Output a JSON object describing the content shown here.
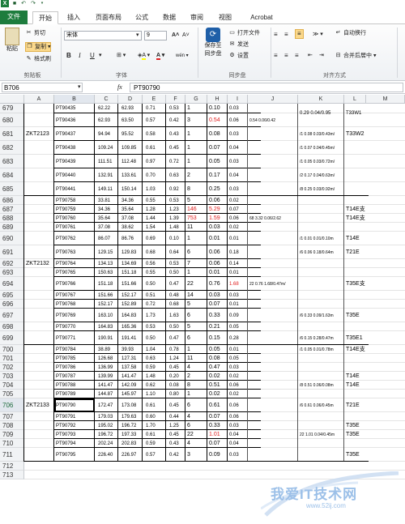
{
  "quick_access": {
    "save_icon": "save-icon",
    "undo_icon": "undo-icon",
    "redo_icon": "redo-icon",
    "app_icon": "excel-icon"
  },
  "tabs": [
    "文件",
    "开始",
    "插入",
    "页面布局",
    "公式",
    "数据",
    "审阅",
    "视图",
    "Acrobat"
  ],
  "clipboard": {
    "paste": "粘贴",
    "cut": "剪切",
    "copy": "复制",
    "format_painter": "格式刷",
    "group": "剪贴板"
  },
  "font": {
    "name": "宋体",
    "size": "9",
    "bold": "B",
    "italic": "I",
    "underline": "U",
    "group": "字体",
    "fill_letter": "A",
    "font_color_letter": "A",
    "grow": "A",
    "shrink": "A"
  },
  "sync": {
    "save_to": "保存至",
    "sync_drive": "同步盘",
    "open_file": "打开文件",
    "send": "发送",
    "settings": "设置",
    "group": "同步盘"
  },
  "alignment": {
    "wrap": "自动换行",
    "merge": "合并后居中",
    "group": "对齐方式"
  },
  "formula_bar": {
    "name_box": "B706",
    "fx": "fx",
    "value": "PT90790"
  },
  "columns": [
    "A",
    "B",
    "C",
    "D",
    "E",
    "F",
    "G",
    "H",
    "I",
    "J",
    "K",
    "L",
    "M"
  ],
  "rows": [
    {
      "n": "679",
      "b": "PT90435",
      "c": "62.22",
      "d": "62.93",
      "e": "0.71",
      "f": "0.53",
      "g": "1",
      "h": "0.10",
      "i": "0.03"
    },
    {
      "n": "680",
      "b": "PT90436",
      "c": "62.93",
      "d": "63.50",
      "e": "0.57",
      "f": "0.42",
      "g": "3",
      "h": "0.54",
      "i": "0.06",
      "j": "0.54 0.06/0.42"
    },
    {
      "n": "681",
      "a": "ZKT2123",
      "b": "PT90437",
      "c": "94.94",
      "d": "95.52",
      "e": "0.58",
      "f": "0.43",
      "g": "1",
      "h": "0.08",
      "i": "0.03",
      "k": "/1 0.08 0.03/0.43m/",
      "l": "T33W2"
    },
    {
      "n": "682",
      "b": "PT90438",
      "c": "109.24",
      "d": "109.85",
      "e": "0.61",
      "f": "0.45",
      "g": "1",
      "h": "0.07",
      "i": "0.04",
      "k": "/1 0.07 0.04/0.45m/"
    },
    {
      "n": "683",
      "b": "PT90439",
      "c": "111.51",
      "d": "112.48",
      "e": "0.97",
      "f": "0.72",
      "g": "1",
      "h": "0.05",
      "i": "0.03",
      "k": "/1 0.05 0.03/0.72m/"
    },
    {
      "n": "684",
      "b": "PT90440",
      "c": "132.91",
      "d": "133.61",
      "e": "0.70",
      "f": "0.63",
      "g": "2",
      "h": "0.17",
      "i": "0.04",
      "k": "/2 0.17 0.04/0.63m/"
    },
    {
      "n": "685",
      "b": "PT90441",
      "c": "149.11",
      "d": "150.14",
      "e": "1.03",
      "f": "0.92",
      "g": "8",
      "h": "0.25",
      "i": "0.03",
      "k": "/8 0.25 0.03/0.92m/"
    },
    {
      "n": "686",
      "b": "PT90758",
      "c": "33.81",
      "d": "34.36",
      "e": "0.55",
      "f": "0.53",
      "g": "5",
      "h": "0.06",
      "i": "0.02"
    },
    {
      "n": "687",
      "b": "PT90759",
      "c": "34.36",
      "d": "35.64",
      "e": "1.28",
      "f": "1.23",
      "g": "146",
      "h": "5.29",
      "i": "0.07",
      "l": "T14E支"
    },
    {
      "n": "688",
      "b": "PT90760",
      "c": "35.64",
      "d": "37.08",
      "e": "1.44",
      "f": "1.39",
      "g": "753",
      "h": "1.59",
      "i": "0.06",
      "j": "68 3.32 0.06/2.62",
      "l": "T14E支"
    },
    {
      "n": "689",
      "b": "PT90761",
      "c": "37.08",
      "d": "38.62",
      "e": "1.54",
      "f": "1.48",
      "g": "11",
      "h": "0.03",
      "i": "0.02"
    },
    {
      "n": "690",
      "b": "PT90762",
      "c": "86.07",
      "d": "86.76",
      "e": "0.69",
      "f": "0.10",
      "g": "1",
      "h": "0.01",
      "i": "0.01",
      "k": "/1 0.01 0.01/0.10m",
      "l": "T14E"
    },
    {
      "n": "691",
      "b": "PT90763",
      "c": "129.15",
      "d": "129.83",
      "e": "0.68",
      "f": "0.64",
      "g": "6",
      "h": "0.06",
      "i": "0.18",
      "k": "/6 0.06 0.18/0.64m",
      "l": "T21E"
    },
    {
      "n": "692",
      "a": "ZKT2132",
      "b": "PT90764",
      "c": "134.13",
      "d": "134.69",
      "e": "0.56",
      "f": "0.53",
      "g": "7",
      "h": "0.06",
      "i": "0.14"
    },
    {
      "n": "693",
      "b": "PT90765",
      "c": "150.63",
      "d": "151.18",
      "e": "0.55",
      "f": "0.50",
      "g": "1",
      "h": "0.01",
      "i": "0.01"
    },
    {
      "n": "694",
      "b": "PT90766",
      "c": "151.18",
      "d": "151.66",
      "e": "0.50",
      "f": "0.47",
      "g": "22",
      "h": "0.76",
      "i": "1.68",
      "j": "22 0.76 1.68/0.47m/",
      "l": "T35E支"
    },
    {
      "n": "695",
      "b": "PT90767",
      "c": "151.66",
      "d": "152.17",
      "e": "0.51",
      "f": "0.48",
      "g": "14",
      "h": "0.03",
      "i": "0.03"
    },
    {
      "n": "696",
      "b": "PT90768",
      "c": "152.17",
      "d": "152.89",
      "e": "0.72",
      "f": "0.68",
      "g": "5",
      "h": "0.07",
      "i": "0.01"
    },
    {
      "n": "697",
      "b": "PT90769",
      "c": "163.10",
      "d": "164.83",
      "e": "1.73",
      "f": "1.63",
      "g": "6",
      "h": "0.33",
      "i": "0.09",
      "k": "/6 0.33 0.09/1.63m",
      "l": "T35E"
    },
    {
      "n": "698",
      "b": "PT90770",
      "c": "164.83",
      "d": "165.36",
      "e": "0.53",
      "f": "0.50",
      "g": "5",
      "h": "0.21",
      "i": "0.05"
    },
    {
      "n": "699",
      "b": "PT90771",
      "c": "190.91",
      "d": "191.41",
      "e": "0.50",
      "f": "0.47",
      "g": "6",
      "h": "0.15",
      "i": "0.28",
      "k": "/6 0.15 0.28/0.47m",
      "l": "T35E1"
    },
    {
      "n": "700",
      "b": "PT90784",
      "c": "38.89",
      "d": "39.93",
      "e": "1.04",
      "f": "0.78",
      "g": "1",
      "h": "0.05",
      "i": "0.01",
      "k": "/1 0.05 0.01/0.78m",
      "l": "T14E支"
    },
    {
      "n": "701",
      "b": "PT90785",
      "c": "126.68",
      "d": "127.31",
      "e": "0.63",
      "f": "1.24",
      "g": "11",
      "h": "0.08",
      "i": "0.05"
    },
    {
      "n": "702",
      "b": "PT90786",
      "c": "136.99",
      "d": "137.58",
      "e": "0.59",
      "f": "0.45",
      "g": "4",
      "h": "0.47",
      "i": "0.03"
    },
    {
      "n": "703",
      "b": "PT90787",
      "c": "139.99",
      "d": "141.47",
      "e": "1.48",
      "f": "0.20",
      "g": "2",
      "h": "0.02",
      "i": "0.02",
      "l": "T14E"
    },
    {
      "n": "704",
      "b": "PT90788",
      "c": "141.47",
      "d": "142.09",
      "e": "0.62",
      "f": "0.08",
      "g": "8",
      "h": "0.51",
      "i": "0.06",
      "k": "/8 0.51 0.06/0.08m",
      "l": "T14E"
    },
    {
      "n": "705",
      "b": "PT90789",
      "c": "144.87",
      "d": "145.97",
      "e": "1.10",
      "f": "0.80",
      "g": "1",
      "h": "0.02",
      "i": "0.02"
    },
    {
      "n": "706",
      "a": "ZKT2133",
      "b": "PT90790",
      "c": "172.47",
      "d": "173.08",
      "e": "0.61",
      "f": "0.45",
      "g": "6",
      "h": "0.61",
      "i": "0.06",
      "k": "/6 0.61 0.06/0.45m",
      "l": "T21E"
    },
    {
      "n": "707",
      "b": "PT90791",
      "c": "179.03",
      "d": "179.63",
      "e": "0.60",
      "f": "0.44",
      "g": "4",
      "h": "0.07",
      "i": "0.06"
    },
    {
      "n": "708",
      "b": "PT90792",
      "c": "195.02",
      "d": "196.72",
      "e": "1.70",
      "f": "1.25",
      "g": "6",
      "h": "0.33",
      "i": "0.03",
      "l": "T35E"
    },
    {
      "n": "709",
      "b": "PT90793",
      "c": "196.72",
      "d": "197.33",
      "e": "0.61",
      "f": "0.45",
      "g": "22",
      "h": "1.01",
      "i": "0.04",
      "k": "22 1.01 0.04/0.45m",
      "l": "T35E"
    },
    {
      "n": "710",
      "b": "PT90794",
      "c": "202.24",
      "d": "202.83",
      "e": "0.59",
      "f": "0.43",
      "g": "4",
      "h": "0.07",
      "i": "0.04"
    },
    {
      "n": "711",
      "b": "PT90795",
      "c": "226.40",
      "d": "226.97",
      "e": "0.57",
      "f": "0.42",
      "g": "3",
      "h": "0.09",
      "i": "0.03",
      "l": "T35E"
    },
    {
      "n": "712"
    },
    {
      "n": "713"
    }
  ],
  "k_top_note": "0.29 0.04/0.95",
  "l_top": "T33W1",
  "k_mid_note": "/1 0.51 0.06/0.08m",
  "k_709_note": "22 1.01 0.04/0.45m",
  "watermark": {
    "text": "我爱IT技术网",
    "url": "www.52ij.com"
  },
  "colors": {
    "excel_green": "#1d7c3d",
    "red_value": "#e02020",
    "selected": "#217346"
  }
}
